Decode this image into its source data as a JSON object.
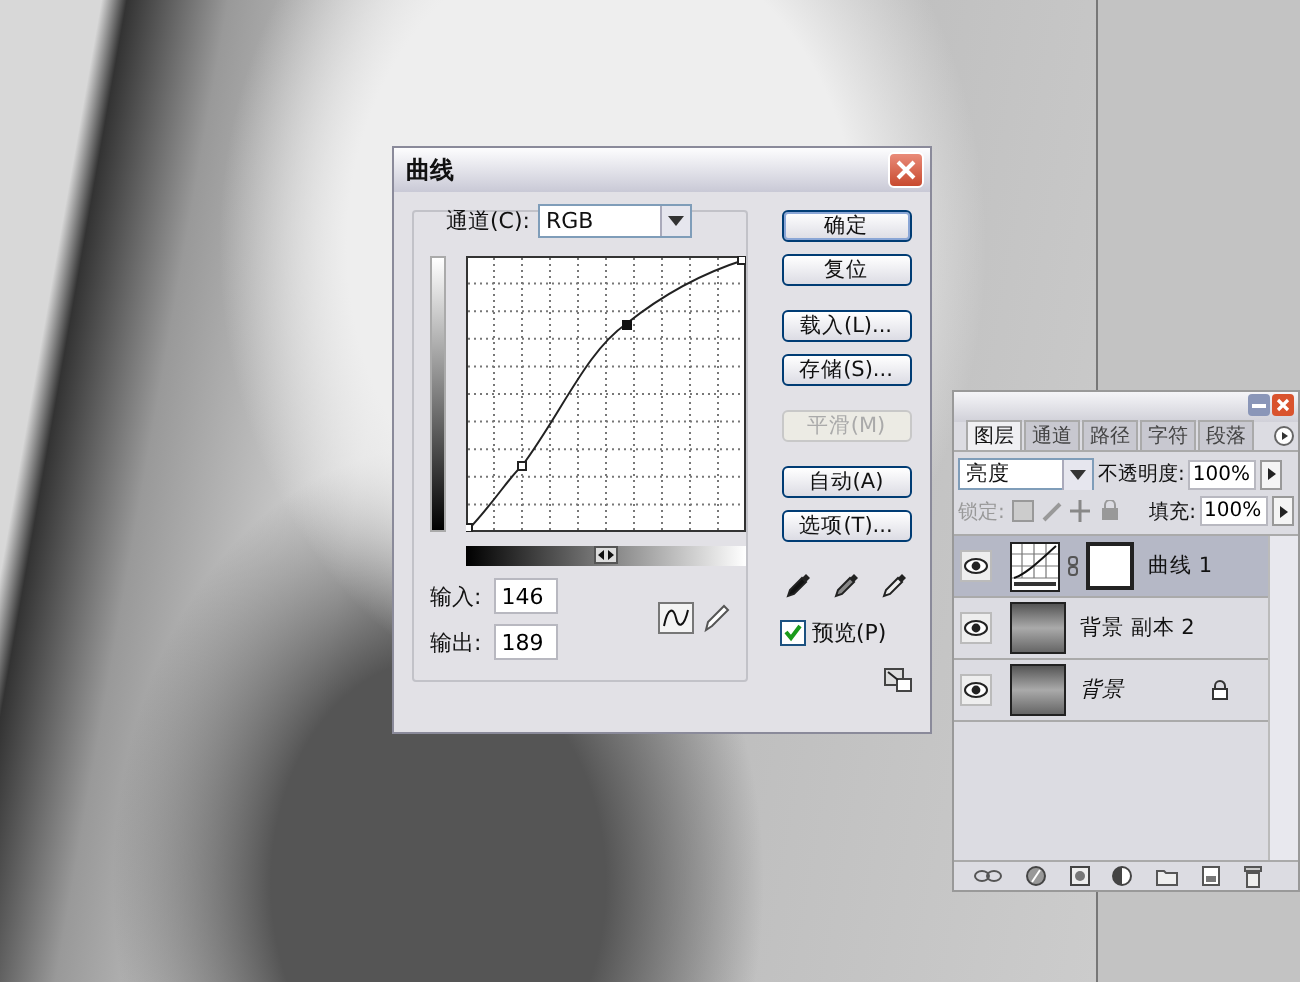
{
  "dialog": {
    "title": "曲线",
    "channel_label": "通道(C):",
    "channel_value": "RGB",
    "input_label": "输入:",
    "input_value": "146",
    "output_label": "输出:",
    "output_value": "189",
    "buttons": [
      {
        "label": "确定",
        "disabled": false,
        "default": true
      },
      {
        "label": "复位",
        "disabled": false,
        "default": false
      },
      {
        "label": "载入(L)...",
        "disabled": false,
        "default": false
      },
      {
        "label": "存储(S)...",
        "disabled": false,
        "default": false
      },
      {
        "label": "平滑(M)",
        "disabled": true,
        "default": false
      },
      {
        "label": "自动(A)",
        "disabled": false,
        "default": false
      },
      {
        "label": "选项(T)...",
        "disabled": false,
        "default": false
      }
    ],
    "preview": {
      "label": "预览(P)",
      "checked": true
    }
  },
  "layers_panel": {
    "tabs": [
      {
        "label": "图层",
        "selected": true
      },
      {
        "label": "通道",
        "selected": false
      },
      {
        "label": "路径",
        "selected": false
      },
      {
        "label": "字符",
        "selected": false
      },
      {
        "label": "段落",
        "selected": false
      }
    ],
    "blend_mode": "亮度",
    "opacity_label": "不透明度:",
    "opacity": "100%",
    "lock_label": "锁定:",
    "fill_label": "填充:",
    "fill": "100%",
    "layers": [
      {
        "name": "曲线 1",
        "kind": "adjustment",
        "selected": true,
        "locked": false
      },
      {
        "name": "背景 副本 2",
        "kind": "image",
        "selected": false,
        "locked": false
      },
      {
        "name": "背景",
        "kind": "image",
        "selected": false,
        "locked": true
      }
    ]
  }
}
